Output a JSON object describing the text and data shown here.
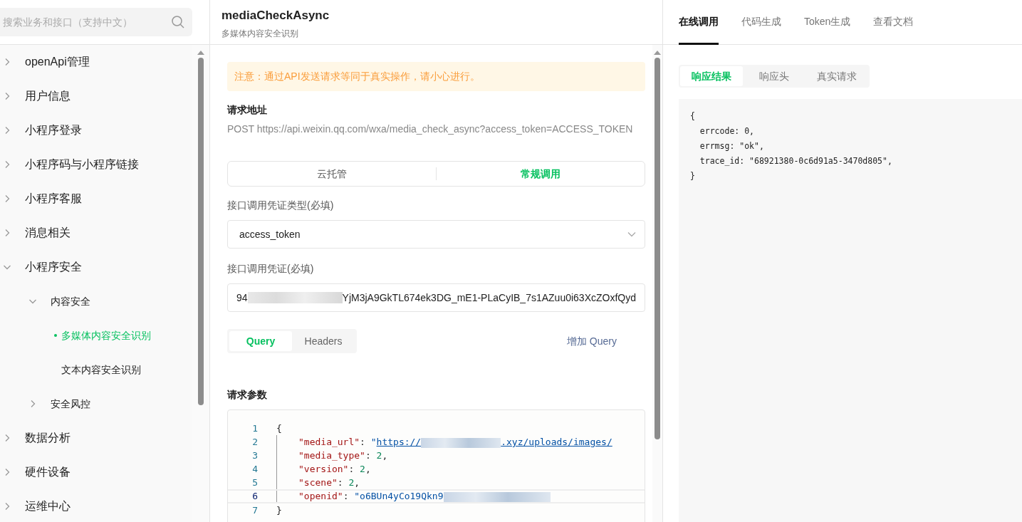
{
  "search": {
    "placeholder": "搜索业务和接口（支持中文）"
  },
  "nav": [
    {
      "kind": "group",
      "label": "openApi管理",
      "expanded": false
    },
    {
      "kind": "group",
      "label": "用户信息",
      "expanded": false
    },
    {
      "kind": "group",
      "label": "小程序登录",
      "expanded": false
    },
    {
      "kind": "group",
      "label": "小程序码与小程序链接",
      "expanded": false
    },
    {
      "kind": "group",
      "label": "小程序客服",
      "expanded": false
    },
    {
      "kind": "group",
      "label": "消息相关",
      "expanded": false
    },
    {
      "kind": "group",
      "label": "小程序安全",
      "expanded": true,
      "children": [
        {
          "kind": "group",
          "label": "内容安全",
          "expanded": true,
          "children": [
            {
              "kind": "leaf",
              "label": "多媒体内容安全识别",
              "selected": true
            },
            {
              "kind": "leaf",
              "label": "文本内容安全识别",
              "selected": false
            }
          ]
        },
        {
          "kind": "group",
          "label": "安全风控",
          "expanded": false
        }
      ]
    },
    {
      "kind": "group",
      "label": "数据分析",
      "expanded": false
    },
    {
      "kind": "group",
      "label": "硬件设备",
      "expanded": false
    },
    {
      "kind": "group",
      "label": "运维中心",
      "expanded": false
    }
  ],
  "header": {
    "title": "mediaCheckAsync",
    "subtitle": "多媒体内容安全识别"
  },
  "notice": "注意：通过API发送请求等同于真实操作，请小心进行。",
  "request_url": {
    "label": "请求地址",
    "value": "POST https://api.weixin.qq.com/wxa/media_check_async?access_token=ACCESS_TOKEN"
  },
  "mode_switch": [
    {
      "label": "云托管",
      "selected": false
    },
    {
      "label": "常规调用",
      "selected": true
    }
  ],
  "credential_type": {
    "label": "接口调用凭证类型(必填)",
    "value": "access_token"
  },
  "credential": {
    "label": "接口调用凭证(必填)",
    "parts": [
      {
        "kind": "text",
        "text": "94"
      },
      {
        "kind": "redacted"
      },
      {
        "kind": "text",
        "text": "YjM3jA9GkTL674ek3DG_mE1-PLaCyIB_7s1AZuu0i63XcZOxfQyd"
      }
    ]
  },
  "param_tabs": [
    {
      "label": "Query",
      "selected": true
    },
    {
      "label": "Headers",
      "selected": false
    }
  ],
  "add_link": "增加 Query",
  "params": {
    "label": "请求参数",
    "lines": [
      {
        "no": "1",
        "current": false,
        "tokens": [
          {
            "kind": "punct",
            "text": "{"
          }
        ]
      },
      {
        "no": "2",
        "current": false,
        "tokens": [
          {
            "kind": "key",
            "text": "\"media_url\""
          },
          {
            "kind": "punct",
            "text": ": "
          },
          {
            "kind": "string",
            "text": "\""
          },
          {
            "kind": "link",
            "text": "https://"
          },
          {
            "kind": "redacted"
          },
          {
            "kind": "link",
            "text": ".xyz/uploads/images/"
          }
        ]
      },
      {
        "no": "3",
        "current": false,
        "tokens": [
          {
            "kind": "key",
            "text": "\"media_type\""
          },
          {
            "kind": "punct",
            "text": ": "
          },
          {
            "kind": "number",
            "text": "2"
          },
          {
            "kind": "punct",
            "text": ","
          }
        ]
      },
      {
        "no": "4",
        "current": false,
        "tokens": [
          {
            "kind": "key",
            "text": "\"version\""
          },
          {
            "kind": "punct",
            "text": ": "
          },
          {
            "kind": "number",
            "text": "2"
          },
          {
            "kind": "punct",
            "text": ","
          }
        ]
      },
      {
        "no": "5",
        "current": false,
        "tokens": [
          {
            "kind": "key",
            "text": "\"scene\""
          },
          {
            "kind": "punct",
            "text": ": "
          },
          {
            "kind": "number",
            "text": "2"
          },
          {
            "kind": "punct",
            "text": ","
          }
        ]
      },
      {
        "no": "6",
        "current": true,
        "tokens": [
          {
            "kind": "key",
            "text": "\"openid\""
          },
          {
            "kind": "punct",
            "text": ": "
          },
          {
            "kind": "string",
            "text": "\"o6BUn4yCo19Qkn9"
          },
          {
            "kind": "redacted"
          }
        ]
      },
      {
        "no": "7",
        "current": false,
        "tokens": [
          {
            "kind": "punct",
            "text": "}"
          }
        ]
      }
    ]
  },
  "main_tabs": [
    {
      "label": "在线调用",
      "selected": true
    },
    {
      "label": "代码生成",
      "selected": false
    },
    {
      "label": "Token生成",
      "selected": false
    },
    {
      "label": "查看文档",
      "selected": false
    }
  ],
  "response_tabs": [
    {
      "label": "响应结果",
      "selected": true
    },
    {
      "label": "响应头",
      "selected": false
    },
    {
      "label": "真实请求",
      "selected": false
    }
  ],
  "response_lines": [
    "{",
    "  errcode: 0,",
    "  errmsg: \"ok\",",
    "  trace_id: \"68921380-0c6d91a5-3470d805\",",
    "}"
  ]
}
